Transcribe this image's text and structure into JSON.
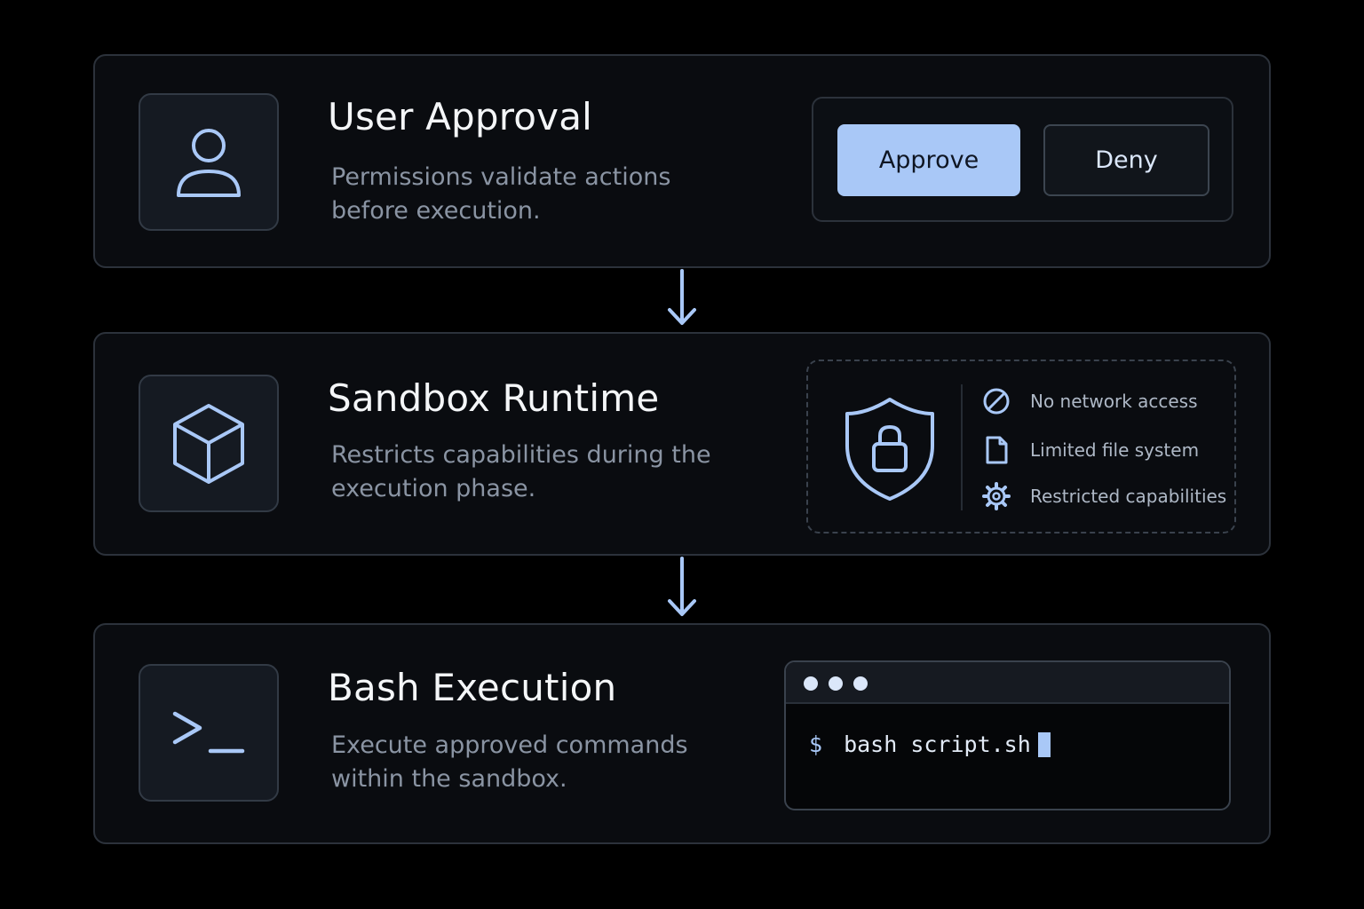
{
  "colors": {
    "background": "#000000",
    "card": "#0a0c10",
    "accent": "#a9c8f7",
    "muted_text": "#8a94a3"
  },
  "steps": [
    {
      "icon": "user-icon",
      "title": "User Approval",
      "description": "Permissions validate actions before execution.",
      "actions": {
        "approve_label": "Approve",
        "deny_label": "Deny"
      }
    },
    {
      "icon": "cube-icon",
      "title": "Sandbox Runtime",
      "description": "Restricts capabilities during the execution phase.",
      "panel_icon": "shield-lock-icon",
      "restrictions": [
        {
          "icon": "no-entry-icon",
          "label": "No network access"
        },
        {
          "icon": "file-icon",
          "label": "Limited file system"
        },
        {
          "icon": "gear-icon",
          "label": "Restricted capabilities"
        }
      ]
    },
    {
      "icon": "terminal-icon",
      "title": "Bash Execution",
      "description": "Execute approved commands within the sandbox.",
      "terminal": {
        "prompt": "$",
        "command": "bash script.sh"
      }
    }
  ],
  "connectors": [
    "arrow-down-icon",
    "arrow-down-icon"
  ]
}
